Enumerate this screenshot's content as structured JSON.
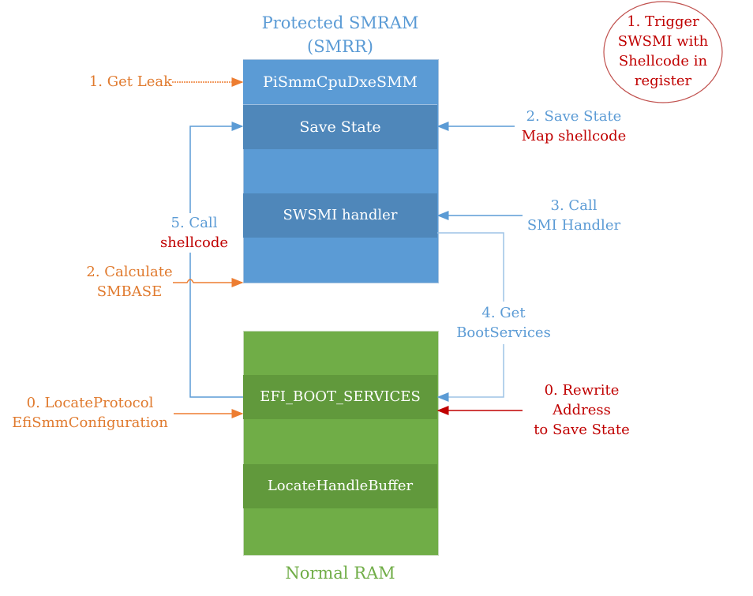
{
  "smram": {
    "title_line1": "Protected SMRAM",
    "title_line2": "(SMRR)",
    "color": "#5b9bd5",
    "block_color": "#4f87ba",
    "blocks": [
      "PiSmmCpuDxeSMM",
      "Save State",
      "SWSMI handler"
    ]
  },
  "normal_ram": {
    "title": "Normal RAM",
    "color": "#70ad47",
    "block_color": "#61993c",
    "blocks": [
      "EFI_BOOT_SERVICES",
      "LocateHandleBuffer"
    ]
  },
  "trigger_ellipse": {
    "lines": [
      "1. Trigger",
      "SWSMI with",
      "Shellcode in",
      "register"
    ],
    "color": "#c00000"
  },
  "annotations": {
    "get_leak": "1. Get Leak",
    "save_state_l1": "2. Save State",
    "save_state_l2": "Map shellcode",
    "call_smi_l1": "3. Call",
    "call_smi_l2": "SMI Handler",
    "call_shellcode_l1": "5. Call",
    "call_shellcode_l2": "shellcode",
    "calc_smbase_l1": "2. Calculate",
    "calc_smbase_l2": "SMBASE",
    "get_boot_l1": "4. Get",
    "get_boot_l2": "BootServices",
    "locate_l1": "0. LocateProtocol",
    "locate_l2": "EfiSmmConfiguration",
    "rewrite_l1": "0. Rewrite",
    "rewrite_l2": "Address",
    "rewrite_l3": "to Save State"
  },
  "colors": {
    "blue_arrow": "#5b9bd5",
    "orange_arrow": "#ed7d31",
    "red_arrow": "#c00000"
  }
}
